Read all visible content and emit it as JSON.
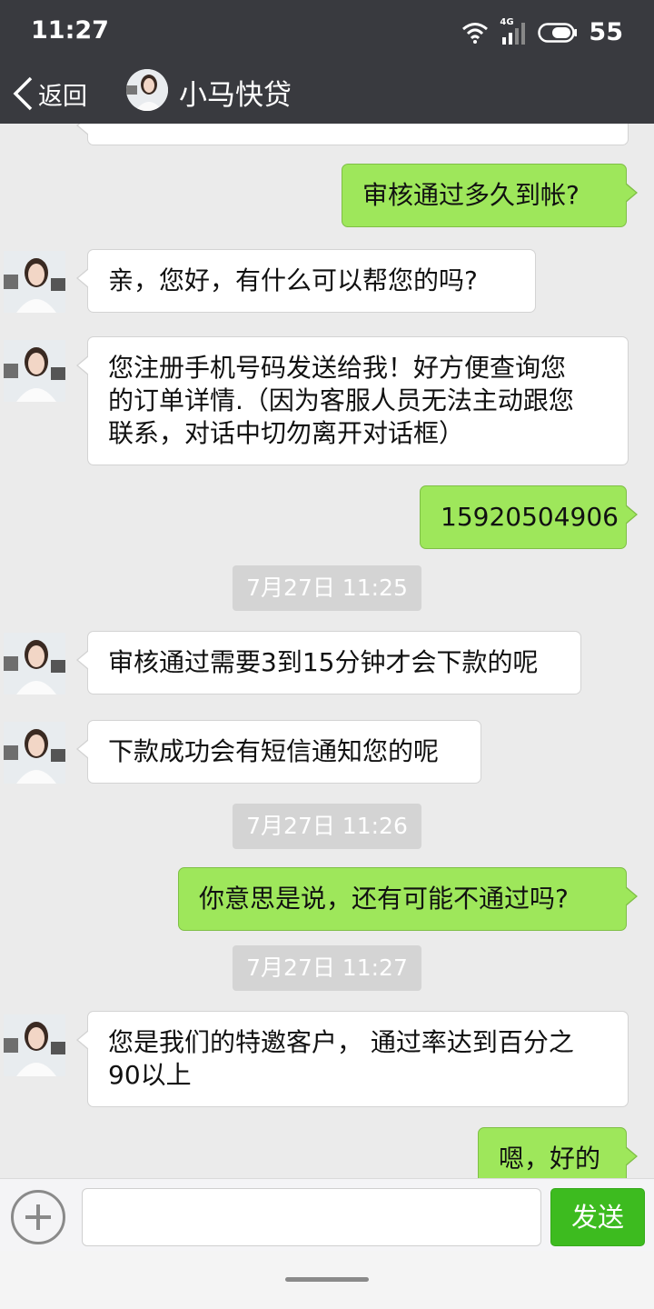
{
  "status_bar": {
    "time": "11:27",
    "network": "4G",
    "battery": "55",
    "icons": [
      "wifi-icon",
      "signal-icon",
      "battery-icon"
    ]
  },
  "header": {
    "back_label": "返回",
    "title": "小马快贷"
  },
  "messages": {
    "m1": "审核通过多久到帐?",
    "m2": "亲，您好，有什么可以帮您的吗?",
    "m3_line1": "您注册手机号码发送给我！好方便查询您",
    "m3_line2": "的订单详情.（因为客服人员无法主动跟您",
    "m3_line3": "联系，对话中切勿离开对话框）",
    "m4": "15920504906",
    "t1": "7月27日 11:25",
    "m5": "审核通过需要3到15分钟才会下款的呢",
    "m6": "下款成功会有短信通知您的呢",
    "t2": "7月27日 11:26",
    "m7": "你意思是说，还有可能不通过吗?",
    "t3": "7月27日 11:27",
    "m8_line1": "您是我们的特邀客户， 通过率达到百分之",
    "m8_line2": "90以上",
    "m9": "嗯，好的"
  },
  "input_bar": {
    "value": "",
    "send_label": "发送"
  },
  "colors": {
    "header_bg": "#393a3f",
    "chat_bg": "#ebebeb",
    "bubble_self": "#9ee75b",
    "bubble_other": "#ffffff",
    "send_button": "#3dbb1f"
  }
}
